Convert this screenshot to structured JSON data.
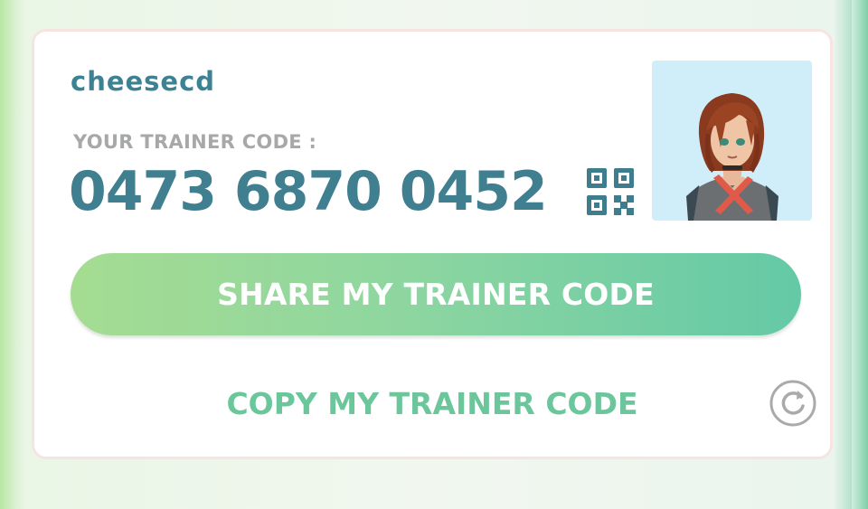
{
  "trainer": {
    "username": "cheesecd",
    "code_label": "YOUR TRAINER CODE :",
    "code": "0473 6870 0452"
  },
  "actions": {
    "share_label": "SHARE MY TRAINER CODE",
    "copy_label": "COPY MY TRAINER CODE"
  },
  "icons": {
    "qr": "qr-code-icon",
    "refresh": "refresh-icon",
    "avatar": "trainer-avatar"
  },
  "colors": {
    "username": "#3c8293",
    "code": "#3f7f90",
    "label": "#a7a8a8",
    "share_gradient_start": "#a5dc92",
    "share_gradient_end": "#64c9a6",
    "copy": "#6cc69b",
    "card_border": "#f6e4e1",
    "avatar_bg": "#cfeef9"
  }
}
